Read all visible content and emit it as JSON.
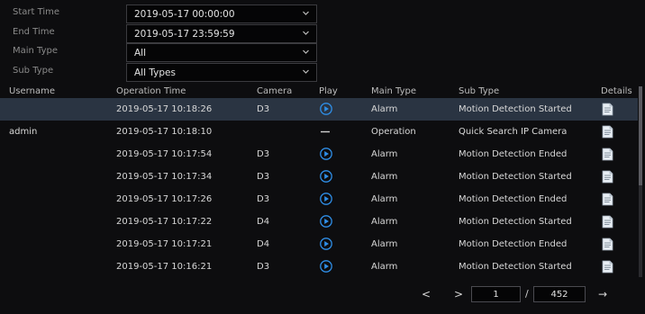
{
  "filters": [
    {
      "label": "Start Time",
      "value": "2019-05-17 00:00:00"
    },
    {
      "label": "End Time",
      "value": "2019-05-17 23:59:59"
    },
    {
      "label": "Main Type",
      "value": "All"
    },
    {
      "label": "Sub Type",
      "value": "All Types"
    }
  ],
  "columns": {
    "username": "Username",
    "time": "Operation Time",
    "camera": "Camera",
    "play": "Play",
    "main": "Main Type",
    "sub": "Sub Type",
    "details": "Details"
  },
  "rows": [
    {
      "user": "",
      "time": "2019-05-17 10:18:26",
      "camera": "D3",
      "play": "play-icon",
      "main": "Alarm",
      "sub": "Motion Detection Started"
    },
    {
      "user": "admin",
      "time": "2019-05-17 10:18:10",
      "camera": "",
      "play": "dash-icon",
      "main": "Operation",
      "sub": "Quick Search IP Camera"
    },
    {
      "user": "",
      "time": "2019-05-17 10:17:54",
      "camera": "D3",
      "play": "play-icon",
      "main": "Alarm",
      "sub": "Motion Detection Ended"
    },
    {
      "user": "",
      "time": "2019-05-17 10:17:34",
      "camera": "D3",
      "play": "play-icon",
      "main": "Alarm",
      "sub": "Motion Detection Started"
    },
    {
      "user": "",
      "time": "2019-05-17 10:17:26",
      "camera": "D3",
      "play": "play-icon",
      "main": "Alarm",
      "sub": "Motion Detection Ended"
    },
    {
      "user": "",
      "time": "2019-05-17 10:17:22",
      "camera": "D4",
      "play": "play-icon",
      "main": "Alarm",
      "sub": "Motion Detection Started"
    },
    {
      "user": "",
      "time": "2019-05-17 10:17:21",
      "camera": "D4",
      "play": "play-icon",
      "main": "Alarm",
      "sub": "Motion Detection Ended"
    },
    {
      "user": "",
      "time": "2019-05-17 10:16:21",
      "camera": "D3",
      "play": "play-icon",
      "main": "Alarm",
      "sub": "Motion Detection Started"
    }
  ],
  "pager": {
    "prev": "<",
    "next": ">",
    "current": "1",
    "separator": "/",
    "total": "452",
    "go": "→"
  },
  "colors": {
    "accent": "#2f8fe8",
    "selected_row": "#2a3442"
  },
  "icons": {
    "dropdown": "chevron-down-icon",
    "play": "play-icon",
    "details": "document-icon"
  }
}
